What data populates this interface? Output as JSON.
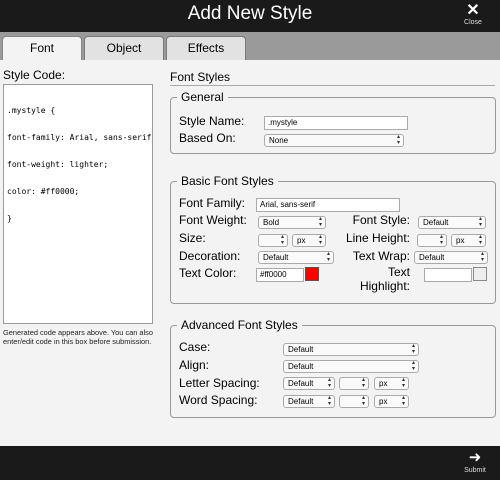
{
  "dialog": {
    "title": "Add New Style",
    "close_label": "Close",
    "submit_label": "Submit"
  },
  "tabs": [
    {
      "label": "Font"
    },
    {
      "label": "Object"
    },
    {
      "label": "Effects"
    }
  ],
  "code": {
    "label": "Style Code:",
    "lines": [
      ".mystyle {",
      "font-family: Arial, sans-serif;",
      "font-weight: lighter;",
      "color: #ff0000;",
      "}"
    ],
    "help": "Generated code appears above. You can also enter/edit code in this box before submission."
  },
  "font_styles": {
    "heading": "Font Styles",
    "general": {
      "legend": "General",
      "style_name_label": "Style Name:",
      "style_name_value": ".mystyle",
      "based_on_label": "Based On:",
      "based_on_value": "None"
    },
    "basic": {
      "legend": "Basic Font Styles",
      "family_label": "Font Family:",
      "family_value": "Arial, sans-serif",
      "weight_label": "Font Weight:",
      "weight_value": "Bold",
      "style_label": "Font Style:",
      "style_value": "Default",
      "size_label": "Size:",
      "size_value": "",
      "size_unit": "px",
      "line_height_label": "Line Height:",
      "line_height_value": "",
      "line_height_unit": "px",
      "decoration_label": "Decoration:",
      "decoration_value": "Default",
      "wrap_label": "Text Wrap:",
      "wrap_value": "Default",
      "color_label": "Text Color:",
      "color_value": "#ff0000",
      "color_swatch": "#ff0000",
      "highlight_label_1": "Text",
      "highlight_label_2": "Highlight:",
      "highlight_value": "",
      "highlight_swatch": "#eeeeee"
    },
    "advanced": {
      "legend": "Advanced Font Styles",
      "case_label": "Case:",
      "case_value": "Default",
      "align_label": "Align:",
      "align_value": "Default",
      "letter_label": "Letter Spacing:",
      "letter_value": "Default",
      "letter_amount": "",
      "letter_unit": "px",
      "word_label": "Word Spacing:",
      "word_value": "Default",
      "word_amount": "",
      "word_unit": "px"
    }
  },
  "icons": {
    "close": "close-x-icon",
    "submit": "sign-in-arrow-icon",
    "dropdown": "up-down-arrow-icon"
  }
}
